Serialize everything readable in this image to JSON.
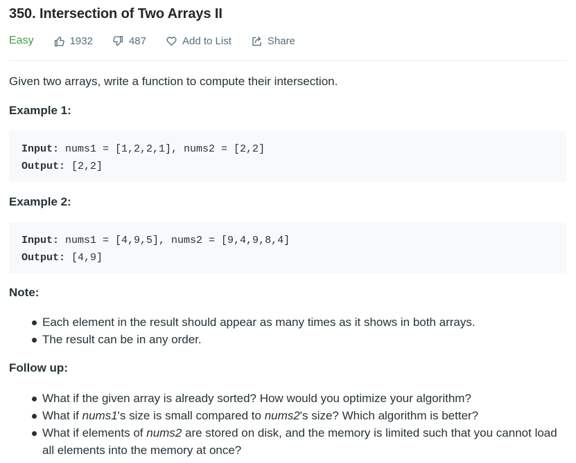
{
  "problem": {
    "title": "350. Intersection of Two Arrays II",
    "difficulty": "Easy",
    "likes": "1932",
    "dislikes": "487",
    "add_to_list_label": "Add to List",
    "share_label": "Share"
  },
  "description": "Given two arrays, write a function to compute their intersection.",
  "examples": [
    {
      "heading": "Example 1:",
      "input_label": "Input:",
      "input_value": " nums1 = [1,2,2,1], nums2 = [2,2]",
      "output_label": "Output:",
      "output_value": " [2,2]"
    },
    {
      "heading": "Example 2:",
      "input_label": "Input:",
      "input_value": " nums1 = [4,9,5], nums2 = [9,4,9,8,4]",
      "output_label": "Output:",
      "output_value": " [4,9]"
    }
  ],
  "note": {
    "heading": "Note:",
    "items": [
      "Each element in the result should appear as many times as it shows in both arrays.",
      "The result can be in any order."
    ]
  },
  "follow_up": {
    "heading": "Follow up:",
    "item1": "What if the given array is already sorted? How would you optimize your algorithm?",
    "item2_a": "What if ",
    "item2_em1": "nums1",
    "item2_b": "'s size is small compared to ",
    "item2_em2": "nums2",
    "item2_c": "'s size? Which algorithm is better?",
    "item3_a": "What if elements of ",
    "item3_em": "nums2",
    "item3_b": " are stored on disk, and the memory is limited such that you cannot load all elements into the memory at once?"
  },
  "icons": {
    "like": "thumbs-up-icon",
    "dislike": "thumbs-down-icon",
    "add_to_list": "heart-icon",
    "share": "share-icon"
  },
  "colors": {
    "difficulty_easy": "#43a047",
    "meta_text": "#546e7a",
    "code_bg": "#f7f9fa"
  }
}
